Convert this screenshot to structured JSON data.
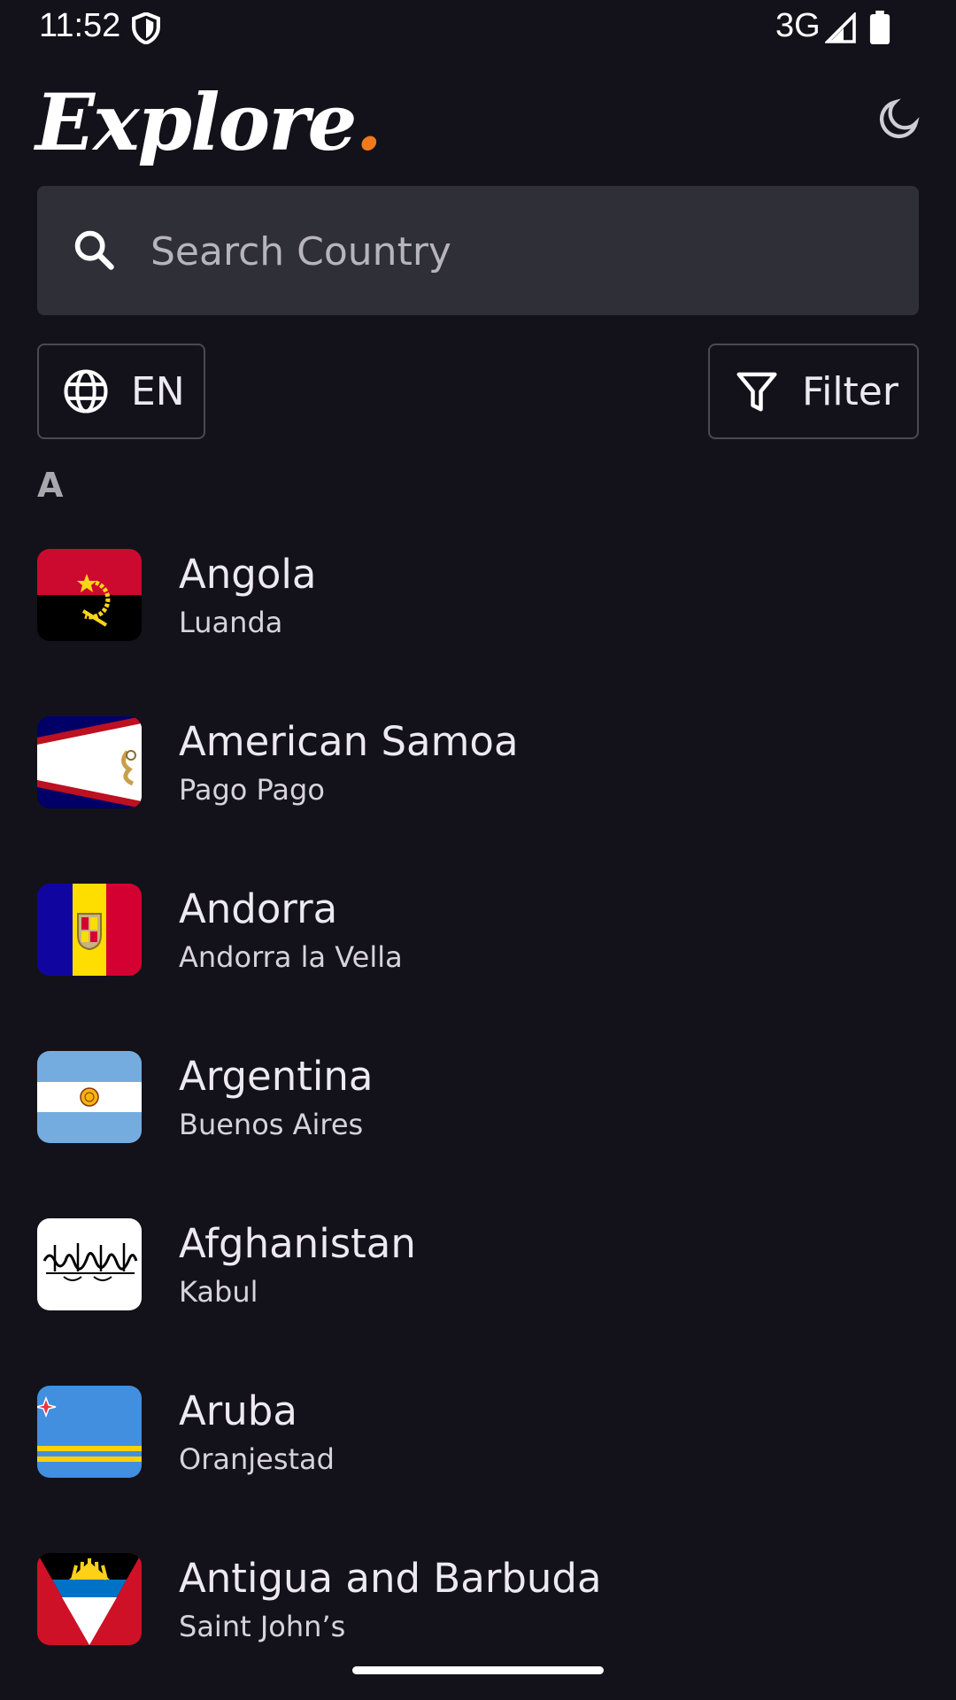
{
  "status_bar": {
    "time": "11:52",
    "network": "3G",
    "icons": [
      "shield-icon",
      "signal-icon",
      "battery-icon"
    ]
  },
  "header": {
    "brand": "Explore",
    "brand_dot": ".",
    "brand_dot_color": "#f07a1a",
    "theme_icon": "moon-icon"
  },
  "search": {
    "placeholder": "Search Country",
    "value": ""
  },
  "controls": {
    "language_label": "EN",
    "filter_label": "Filter"
  },
  "section": {
    "letter": "A"
  },
  "countries": [
    {
      "name": "Angola",
      "capital": "Luanda",
      "flag": "angola-flag-icon"
    },
    {
      "name": "American Samoa",
      "capital": "Pago Pago",
      "flag": "american-samoa-flag-icon"
    },
    {
      "name": "Andorra",
      "capital": "Andorra la Vella",
      "flag": "andorra-flag-icon"
    },
    {
      "name": "Argentina",
      "capital": "Buenos Aires",
      "flag": "argentina-flag-icon"
    },
    {
      "name": "Afghanistan",
      "capital": "Kabul",
      "flag": "afghanistan-flag-icon"
    },
    {
      "name": "Aruba",
      "capital": "Oranjestad",
      "flag": "aruba-flag-icon"
    },
    {
      "name": "Antigua and Barbuda",
      "capital": "Saint John’s",
      "flag": "antigua-and-barbuda-flag-icon"
    }
  ],
  "colors": {
    "background": "#13121a",
    "search_background": "#2f2f38",
    "accent": "#f07a1a"
  }
}
